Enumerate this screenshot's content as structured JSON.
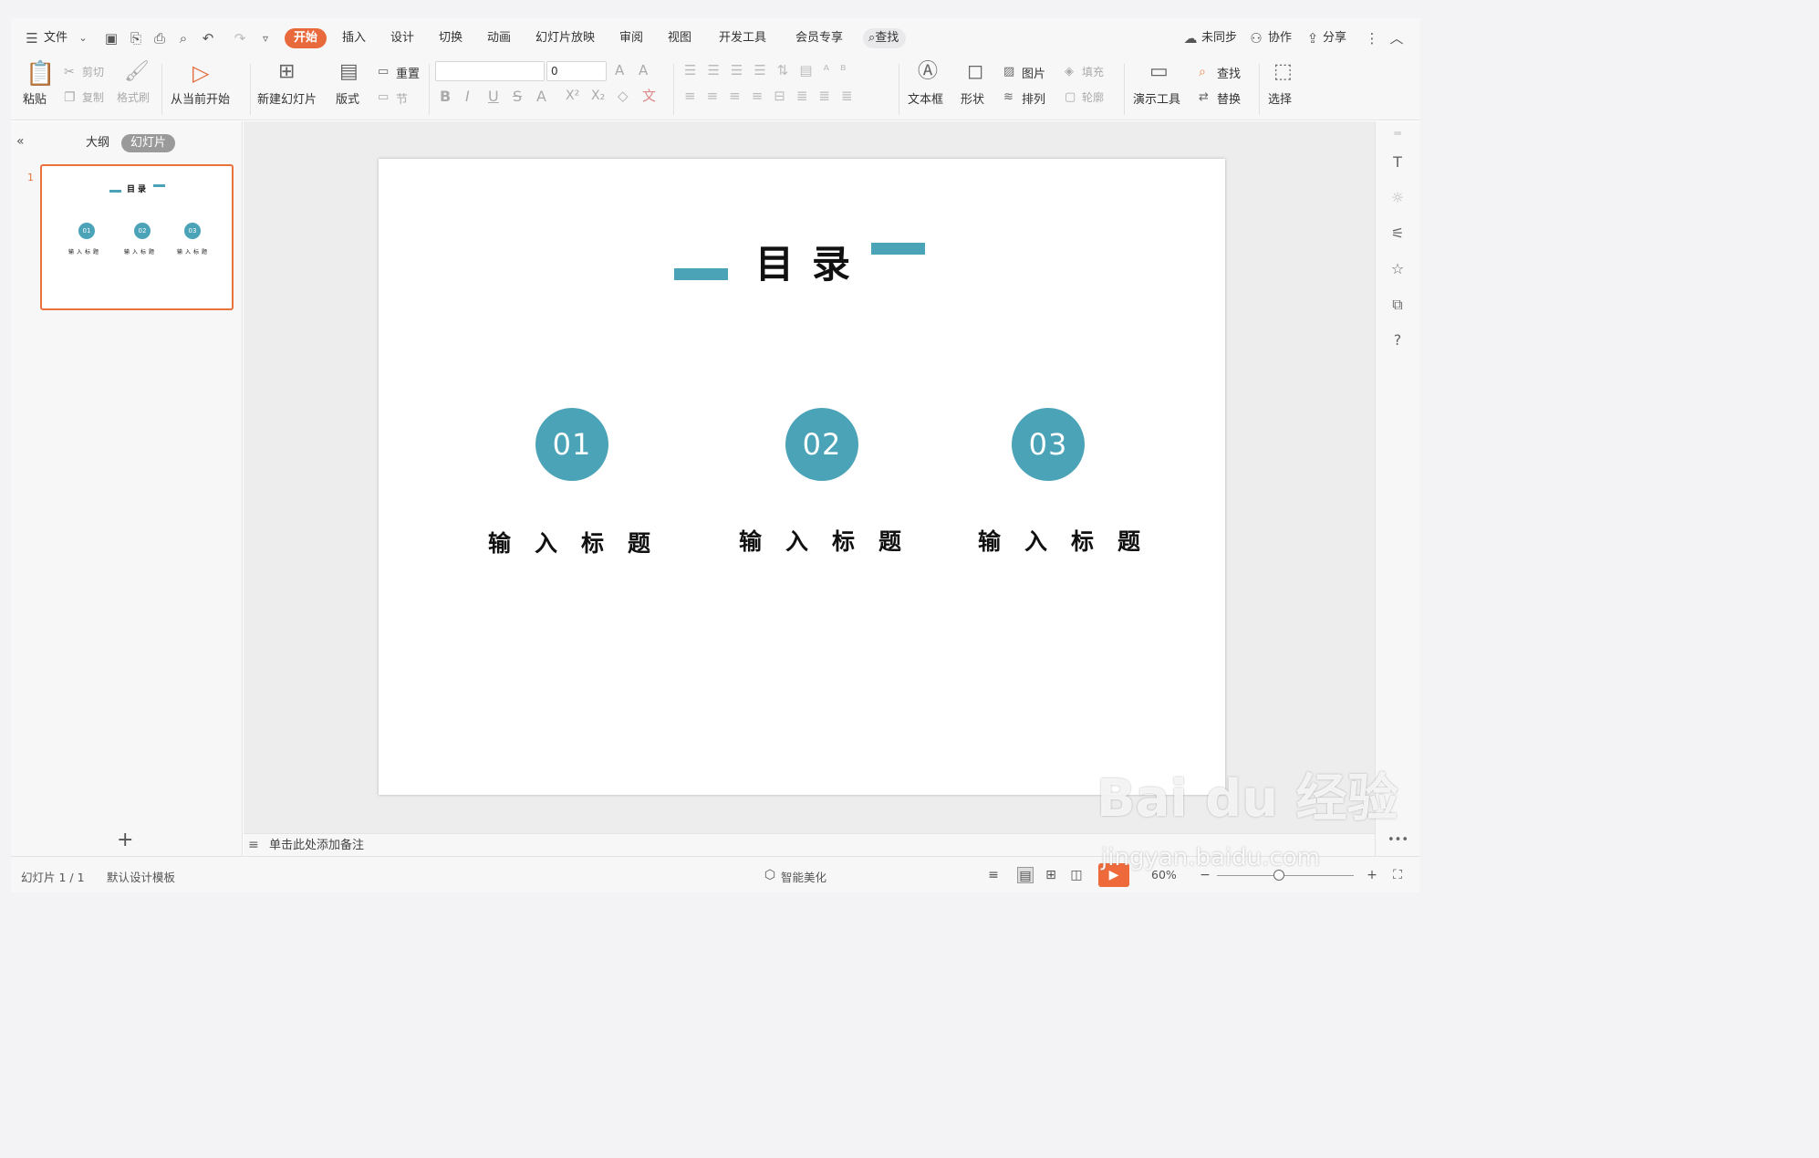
{
  "menu": {
    "file": "文件",
    "tabs": [
      "开始",
      "插入",
      "设计",
      "切换",
      "动画",
      "幻灯片放映",
      "审阅",
      "视图",
      "开发工具",
      "会员专享"
    ],
    "active_tab": "开始",
    "search": "查找",
    "sync": "未同步",
    "collab": "协作",
    "share": "分享"
  },
  "ribbon": {
    "paste": "粘贴",
    "cut": "剪切",
    "copy": "复制",
    "format_painter": "格式刷",
    "play_from_current": "从当前开始",
    "new_slide": "新建幻灯片",
    "layout": "版式",
    "reset": "重置",
    "section": "节",
    "font_size": "0",
    "text_box": "文本框",
    "shape": "形状",
    "picture": "图片",
    "fill": "填充",
    "arrange": "排列",
    "outline": "轮廓",
    "present_tools": "演示工具",
    "find": "查找",
    "replace": "替换",
    "select": "选择"
  },
  "left_panel": {
    "tab_outline": "大纲",
    "tab_slides": "幻灯片",
    "slide_number": "1"
  },
  "slide": {
    "title": "目录",
    "items": [
      {
        "num": "01",
        "label": "输入标题"
      },
      {
        "num": "02",
        "label": "输入标题"
      },
      {
        "num": "03",
        "label": "输入标题"
      }
    ],
    "accent_color": "#4ba3b8"
  },
  "notes_placeholder": "单击此处添加备注",
  "status": {
    "slide_info": "幻灯片 1 / 1",
    "template": "默认设计模板",
    "beautify": "智能美化",
    "zoom": "60%"
  },
  "watermark": {
    "brand": "Bai du 经验",
    "url": "jingyan.baidu.com"
  }
}
